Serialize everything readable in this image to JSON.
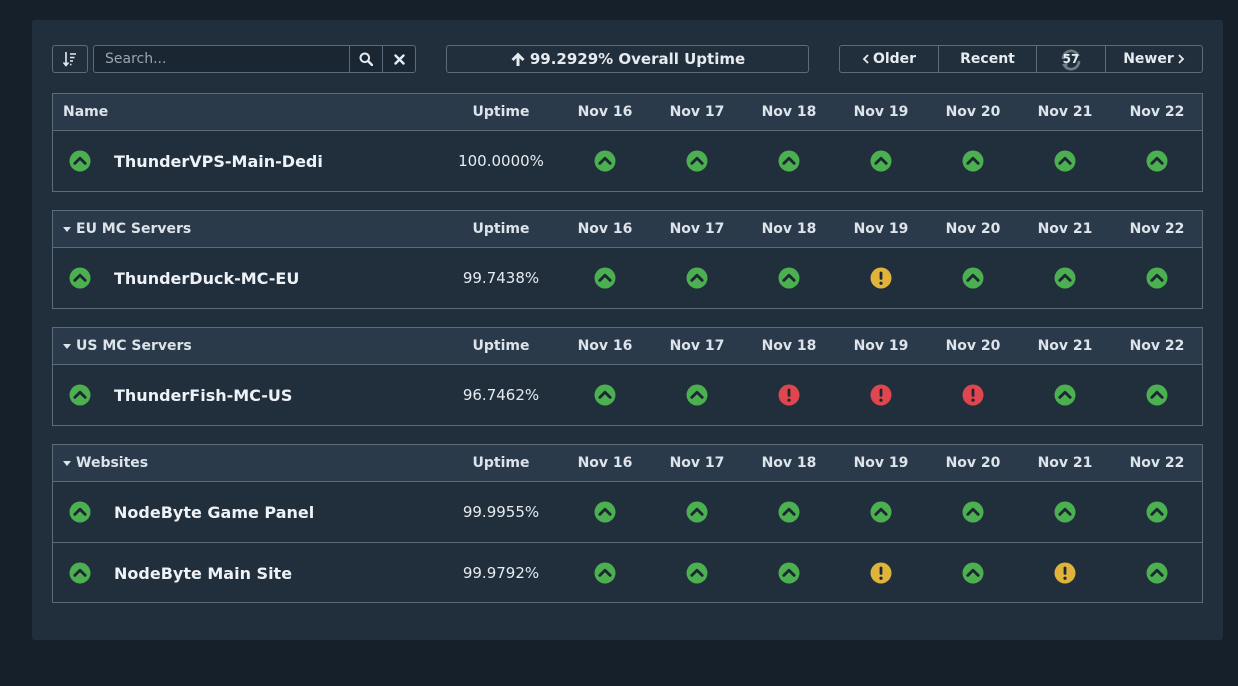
{
  "toolbar": {
    "sort_icon": "sort-icon",
    "search_placeholder": "Search...",
    "search_value": "",
    "search_icon": "search-icon",
    "clear_icon": "close-icon",
    "overall_uptime": "99.2929% Overall Uptime",
    "older_label": "Older",
    "recent_label": "Recent",
    "refresh_count": "57",
    "newer_label": "Newer"
  },
  "colors": {
    "up": "#4caf50",
    "warning": "#e0b43a",
    "down": "#e0464e"
  },
  "columns": {
    "uptime": "Uptime",
    "dates": [
      "Nov 16",
      "Nov 17",
      "Nov 18",
      "Nov 19",
      "Nov 20",
      "Nov 21",
      "Nov 22"
    ]
  },
  "groups": [
    {
      "header": "Name",
      "collapsible": false,
      "monitors": [
        {
          "name": "ThunderVPS-Main-Dedi",
          "status": "up",
          "uptime": "100.0000%",
          "days": [
            "up",
            "up",
            "up",
            "up",
            "up",
            "up",
            "up"
          ]
        }
      ]
    },
    {
      "header": "EU MC Servers",
      "collapsible": true,
      "monitors": [
        {
          "name": "ThunderDuck-MC-EU",
          "status": "up",
          "uptime": "99.7438%",
          "days": [
            "up",
            "up",
            "up",
            "warning",
            "up",
            "up",
            "up"
          ]
        }
      ]
    },
    {
      "header": "US MC Servers",
      "collapsible": true,
      "monitors": [
        {
          "name": "ThunderFish-MC-US",
          "status": "up",
          "uptime": "96.7462%",
          "days": [
            "up",
            "up",
            "down",
            "down",
            "down",
            "up",
            "up"
          ]
        }
      ]
    },
    {
      "header": "Websites",
      "collapsible": true,
      "monitors": [
        {
          "name": "NodeByte Game Panel",
          "status": "up",
          "uptime": "99.9955%",
          "days": [
            "up",
            "up",
            "up",
            "up",
            "up",
            "up",
            "up"
          ]
        },
        {
          "name": "NodeByte Main Site",
          "status": "up",
          "uptime": "99.9792%",
          "days": [
            "up",
            "up",
            "up",
            "warning",
            "up",
            "warning",
            "up"
          ]
        }
      ]
    }
  ]
}
